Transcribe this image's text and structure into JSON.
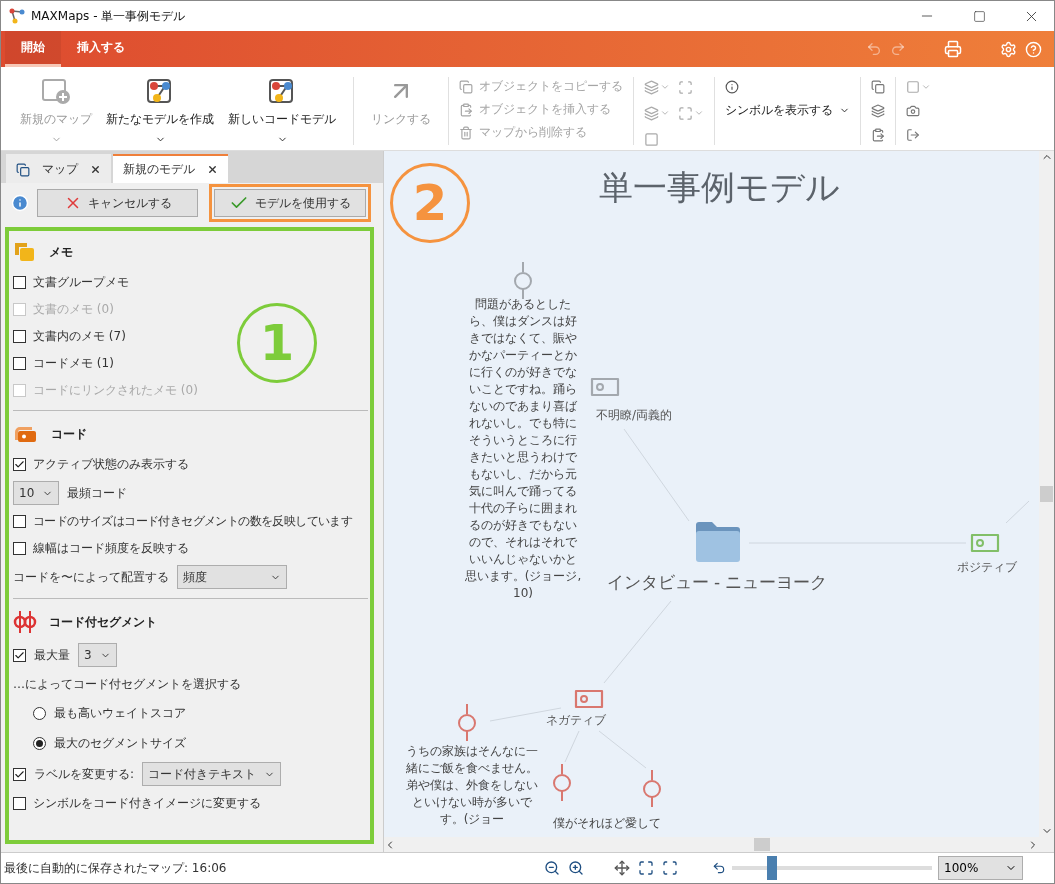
{
  "window": {
    "title": "MAXMaps - 単一事例モデル"
  },
  "ribbon": {
    "tabs": [
      {
        "label": "開始",
        "selected": true
      },
      {
        "label": "挿入する",
        "selected": false
      }
    ]
  },
  "toolbar": {
    "large_buttons": [
      {
        "label": "新規のマップ",
        "disabled": true,
        "kind": "new_map"
      },
      {
        "label": "新たなモデルを作成",
        "disabled": false,
        "kind": "model"
      },
      {
        "label": "新しいコードモデル",
        "disabled": false,
        "kind": "model"
      }
    ],
    "link_button": {
      "label": "リンクする",
      "disabled": true
    },
    "object_commands": [
      {
        "label": "オブジェクトをコピーする",
        "kind": "copy",
        "disabled": true
      },
      {
        "label": "オブジェクトを挿入する",
        "kind": "paste",
        "disabled": true
      },
      {
        "label": "マップから削除する",
        "kind": "delete",
        "disabled": true
      }
    ],
    "symbol_dropdown": {
      "label": "シンボルを表示する"
    }
  },
  "model_panel": {
    "tabs": [
      {
        "label": "マップ",
        "selected": false
      },
      {
        "label": "新規のモデル",
        "selected": true
      }
    ],
    "cancel_button": "キャンセルする",
    "apply_button": "モデルを使用する",
    "callout": "1",
    "sections": [
      {
        "kind": "memo",
        "title": "メモ",
        "items": [
          {
            "kind": "checkbox",
            "label": "文書グループメモ",
            "checked": false,
            "disabled": false
          },
          {
            "kind": "checkbox",
            "label": "文書のメモ (0)",
            "checked": false,
            "disabled": true
          },
          {
            "kind": "checkbox",
            "label": "文書内のメモ (7)",
            "checked": false,
            "disabled": false
          },
          {
            "kind": "checkbox",
            "label": "コードメモ (1)",
            "checked": false,
            "disabled": false
          },
          {
            "kind": "checkbox",
            "label": "コードにリンクされたメモ (0)",
            "checked": false,
            "disabled": true
          }
        ]
      },
      {
        "kind": "code",
        "title": "コード",
        "items": [
          {
            "kind": "checkbox",
            "label": "アクティブ状態のみ表示する",
            "checked": true,
            "disabled": false
          },
          {
            "kind": "select_label",
            "value": "10",
            "label": "最頻コード"
          },
          {
            "kind": "checkbox",
            "label": "コードのサイズはコード付きセグメントの数を反映しています",
            "checked": false,
            "disabled": false
          },
          {
            "kind": "checkbox",
            "label": "線幅はコード頻度を反映する",
            "checked": false,
            "disabled": false
          },
          {
            "kind": "label_select",
            "label": "コードを〜によって配置する",
            "value": "頻度"
          }
        ]
      },
      {
        "kind": "segment",
        "title": "コード付セグメント",
        "items": [
          {
            "kind": "checkbox_select",
            "label": "最大量",
            "checked": true,
            "value": "3"
          },
          {
            "kind": "text",
            "label": "…によってコード付セグメントを選択する"
          },
          {
            "kind": "radio",
            "label": "最も高いウェイトスコア",
            "selected": false
          },
          {
            "kind": "radio",
            "label": "最大のセグメントサイズ",
            "selected": true
          },
          {
            "kind": "checkbox_select",
            "label": "ラベルを変更する:",
            "checked": true,
            "value": "コード付きテキスト"
          },
          {
            "kind": "checkbox",
            "label": "シンボルをコード付きイメージに変更する",
            "checked": false,
            "disabled": false
          }
        ]
      }
    ]
  },
  "canvas": {
    "title": "単一事例モデル",
    "callout": "2",
    "center_node": "インタビュー - ニューヨーク",
    "codes": [
      {
        "label": "不明瞭/両義的",
        "color": "#a3a8ae"
      },
      {
        "label": "ポジティブ",
        "color": "#82bf68"
      },
      {
        "label": "ネガティブ",
        "color": "#d9776f"
      }
    ],
    "segments": [
      {
        "color": "#a3a8ae"
      },
      {
        "color": "#d9776f"
      },
      {
        "color": "#d9776f"
      },
      {
        "color": "#d9776f"
      }
    ],
    "quotes": [
      "問題があるとしたら、僕はダンスは好きではなくて、賑やかなパーティーとかに行くのが好きでないことですね。踊らないのであまり喜ばれないし。でも特にそういうところに行きたいと思うわけでもないし、だから元気に叫んで踊ってる十代の子らに囲まれるのが好きでもないので、それはそれでいいんじゃないかと思います。(ジョージ, 10)",
      "うちの家族はそんなに一緒にご飯を食べません。弟や僕は、外食をしないといけない時が多いです。(ジョー",
      "僕がそれほど愛して"
    ]
  },
  "status_bar": {
    "text": "最後に自動的に保存されたマップ: 16:06",
    "zoom": "100%",
    "zoom_slider": {
      "level": 0.2
    }
  }
}
